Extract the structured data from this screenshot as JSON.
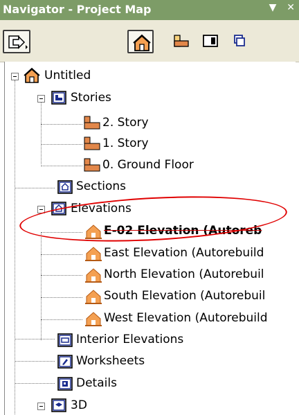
{
  "window": {
    "title": "Navigator - Project Map",
    "dropdown_glyph": "▼",
    "close_glyph": "✕"
  },
  "toolbar": {
    "buttons": [
      {
        "name": "publish-menu-icon"
      },
      {
        "name": "project-map-icon",
        "pressed": true
      },
      {
        "name": "view-map-icon"
      },
      {
        "name": "layout-book-icon"
      },
      {
        "name": "publisher-sets-icon"
      }
    ]
  },
  "tree": {
    "root": "Untitled",
    "stories": "Stories",
    "story_2": "2. Story",
    "story_1": "1. Story",
    "story_0": "0. Ground Floor",
    "sections": "Sections",
    "elevations": "Elevations",
    "elev_e02": "E-02 Elevation (Autoreb",
    "elev_east": "East Elevation (Autorebuild",
    "elev_north": "North Elevation (Autorebuil",
    "elev_south": "South Elevation (Autorebuil",
    "elev_west": "West Elevation (Autorebuild",
    "interior": "Interior Elevations",
    "worksheets": "Worksheets",
    "details": "Details",
    "threed": "3D"
  },
  "colors": {
    "titlebar": "#7d9c67",
    "annotation": "#e00000",
    "story_icon": "#e2874a",
    "house_icon": "#f4a052"
  }
}
